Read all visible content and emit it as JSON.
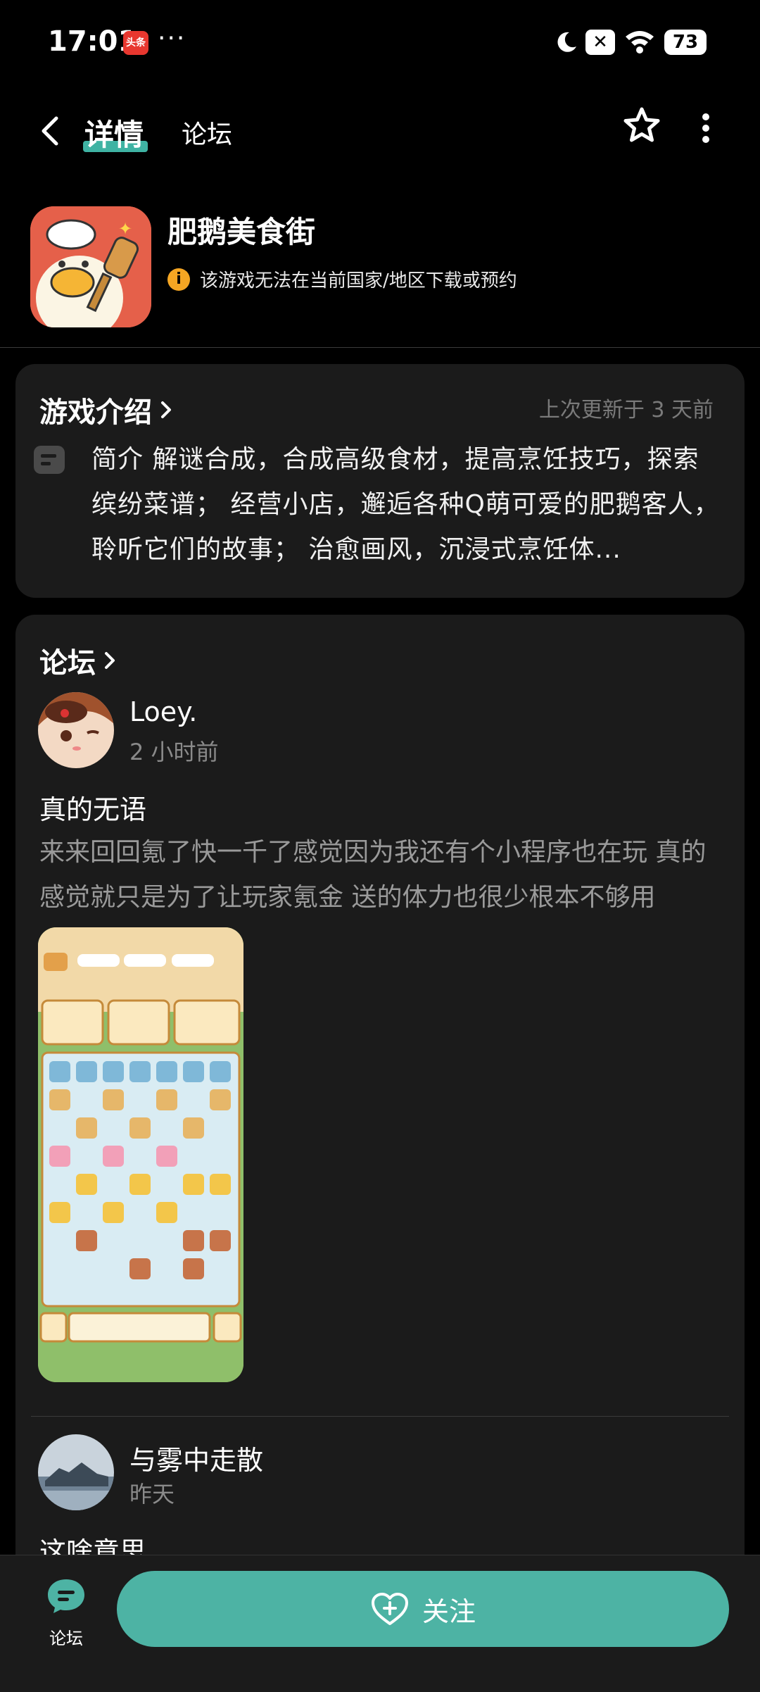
{
  "status_bar": {
    "time": "17:01",
    "app_badge": "头条",
    "more": "···",
    "battery": "73"
  },
  "nav": {
    "tab_detail": "详情",
    "tab_forum": "论坛"
  },
  "app": {
    "name": "肥鹅美食街",
    "notice": "该游戏无法在当前国家/地区下载或预约"
  },
  "intro": {
    "title": "游戏介绍",
    "updated": "上次更新于 3 天前",
    "text": "简介 解谜合成，合成高级食材，提高烹饪技巧，探索缤纷菜谱； 经营小店，邂逅各种Q萌可爱的肥鹅客人，聆听它们的故事； 治愈画风，沉浸式烹饪体..."
  },
  "forum": {
    "title": "论坛",
    "posts": [
      {
        "user": "Loey.",
        "time": "2 小时前",
        "title": "真的无语",
        "body": "来来回回氪了快一千了感觉因为我还有个小程序也在玩 真的感觉就只是为了让玩家氪金 送的体力也很少根本不够用"
      },
      {
        "user": "与雾中走散",
        "time": "昨天",
        "title": "这啥意思"
      }
    ]
  },
  "bottom": {
    "forum_label": "论坛",
    "follow_label": "关注"
  },
  "colors": {
    "accent": "#4db3a4",
    "background": "#000000",
    "card": "#1b1b1b",
    "warning": "#f5a623"
  }
}
